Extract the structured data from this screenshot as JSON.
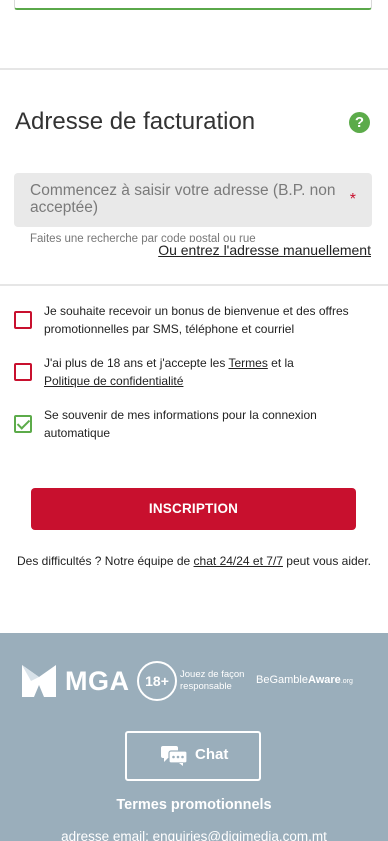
{
  "billing": {
    "title": "Adresse de facturation",
    "help_icon": "question-mark-icon",
    "help_glyph": "?",
    "address_placeholder": "Commencez à saisir votre adresse (B.P. non acceptée)",
    "required_marker": "*",
    "hint": "Faites une recherche par code postal ou rue",
    "manual_link": "Ou entrez l'adresse manuellement"
  },
  "consents": [
    {
      "text": "Je souhaite recevoir un bonus de bienvenue et des offres promotionnelles par SMS, téléphone et courriel",
      "checked": false
    },
    {
      "text_before": "J'ai plus de 18 ans et j'accepte les ",
      "terms_link": "Termes",
      "text_middle": " et la",
      "privacy_link": "Politique de confidentialité",
      "checked": false
    },
    {
      "text": "Se souvenir de mes informations pour la connexion automatique",
      "checked": true
    }
  ],
  "submit_label": "INSCRIPTION",
  "help": {
    "before": "Des difficultés ? Notre équipe de ",
    "link": "chat 24/24 et 7/7",
    "after": " peut vous aider."
  },
  "footer": {
    "mga": "MGA",
    "age_badge": "18+",
    "age_text_1": "Jouez de façon",
    "age_text_2": "responsable",
    "bga_1": "BeGamble",
    "bga_2": "Aware",
    "bga_org": ".org",
    "chat_label": "Chat",
    "chat_icon": "chat-bubbles-icon",
    "promo_terms": "Termes promotionnels",
    "email_line": "adresse email: enquiries@digimedia.com.mt"
  },
  "colors": {
    "accent_red": "#c8102e",
    "green": "#5cab4a",
    "footer_bg": "#9aaebb"
  }
}
